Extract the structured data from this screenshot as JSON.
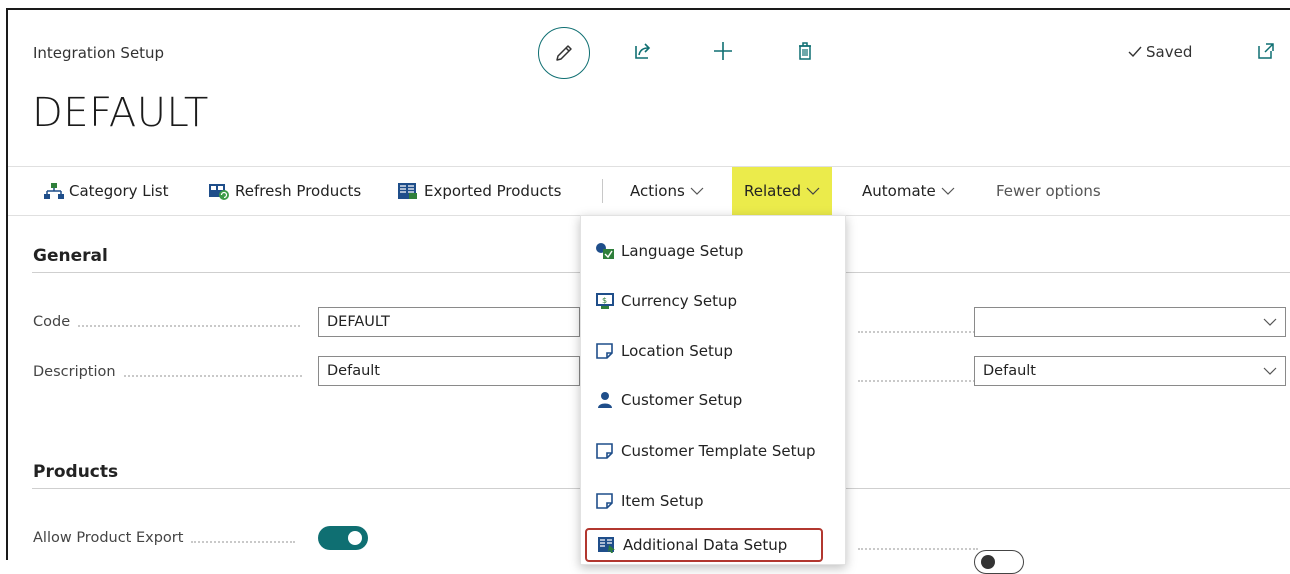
{
  "header": {
    "breadcrumb": "Integration Setup",
    "title": "DEFAULT",
    "saved_label": "Saved"
  },
  "actionbar": {
    "category_list": "Category List",
    "refresh_products": "Refresh Products",
    "exported_products": "Exported Products",
    "actions": "Actions",
    "related": "Related",
    "automate": "Automate",
    "fewer_options": "Fewer options"
  },
  "general": {
    "title": "General",
    "code_label": "Code",
    "code_value": "DEFAULT",
    "description_label": "Description",
    "description_value": "Default",
    "right_select_1_value": "",
    "right_select_2_value": "Default"
  },
  "products": {
    "title": "Products",
    "allow_export_label": "Allow Product Export",
    "allow_export_on": true,
    "right_toggle_on": false
  },
  "related_menu": {
    "items": [
      {
        "label": "Language Setup",
        "icon": "language-setup-icon"
      },
      {
        "label": "Currency Setup",
        "icon": "currency-setup-icon"
      },
      {
        "label": "Location Setup",
        "icon": "page-icon"
      },
      {
        "label": "Customer Setup",
        "icon": "customer-icon"
      },
      {
        "label": "Customer Template Setup",
        "icon": "page-icon"
      },
      {
        "label": "Item Setup",
        "icon": "page-icon"
      },
      {
        "label": "Additional Data Setup",
        "icon": "additional-data-icon"
      }
    ]
  },
  "colors": {
    "accent": "#0f6f72",
    "related_highlight": "#ebeb4b",
    "menu_highlight_border": "#b2372f"
  }
}
